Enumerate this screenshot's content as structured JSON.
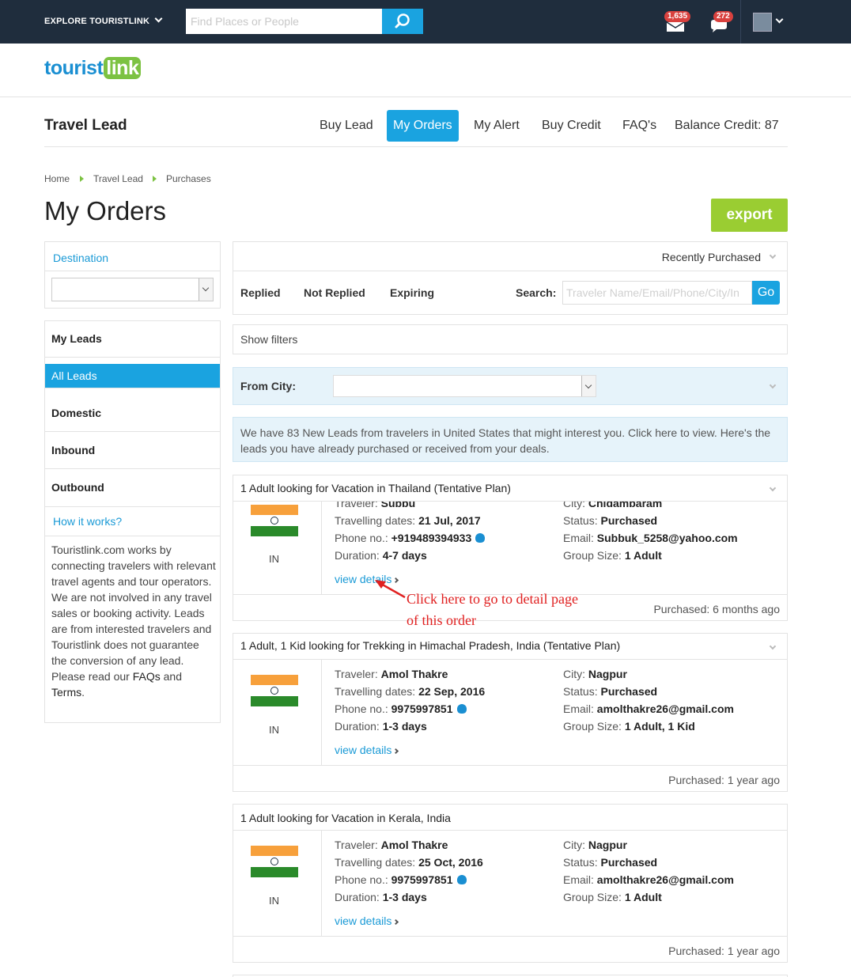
{
  "topbar": {
    "explore_label": "EXPLORE TOURISTLINK",
    "search_placeholder": "Find Places or People",
    "notif_count": "1,635",
    "msg_count": "272"
  },
  "logo": {
    "part1": "tourist",
    "part2": "link"
  },
  "header": {
    "title": "Travel Lead",
    "nav": [
      "Buy Lead",
      "My Orders",
      "My Alert",
      "Buy Credit",
      "FAQ's",
      "Balance Credit: 87"
    ]
  },
  "breadcrumb": [
    "Home",
    "Travel Lead",
    "Purchases"
  ],
  "page": {
    "title": "My Orders",
    "export_label": "export"
  },
  "sidebar": {
    "destination_label": "Destination",
    "menu": [
      "My Leads",
      "All Leads",
      "Domestic",
      "Inbound",
      "Outbound"
    ],
    "how_title": "How it works?",
    "how_text": "Touristlink.com works by connecting travelers with relevant travel agents and tour operators. We are not involved in any travel sales or booking activity. Leads are from interested travelers and Touristlink does not guarantee the conversion of any lead. Please read our ",
    "how_faq": "FAQs",
    "how_and": " and ",
    "how_terms": "Terms",
    "how_end": "."
  },
  "filters": {
    "sort_label": "Recently Purchased",
    "tabs": [
      "Replied",
      "Not Replied",
      "Expiring"
    ],
    "search_label": "Search:",
    "search_placeholder": "Traveler Name/Email/Phone/City/In",
    "go_label": "Go",
    "show_filters": "Show filters",
    "from_city_label": "From City:"
  },
  "info_text": "We have 83 New Leads from travelers in United States that might interest you. Click here to view. Here's the leads you have already purchased or received from your deals.",
  "labels": {
    "traveler": "Traveler:",
    "dates": "Travelling dates:",
    "phone": "Phone no.:",
    "duration": "Duration:",
    "city": "City:",
    "status": "Status:",
    "email": "Email:",
    "group": "Group Size:",
    "view_details": "view details"
  },
  "orders": [
    {
      "title": "1 Adult looking for Vacation in Thailand (Tentative Plan)",
      "country": "IN",
      "traveler": "Subbu",
      "dates": "21 Jul, 2017",
      "phone": "+919489394933",
      "duration": "4-7 days",
      "city": "Chidambaram",
      "status": "Purchased",
      "email": "Subbuk_5258@yahoo.com",
      "group": "1 Adult",
      "purchased": "Purchased: 6 months ago"
    },
    {
      "title": "1 Adult, 1 Kid looking for Trekking in Himachal Pradesh, India (Tentative Plan)",
      "country": "IN",
      "traveler": "Amol Thakre",
      "dates": "22 Sep, 2016",
      "phone": "9975997851",
      "duration": "1-3 days",
      "city": "Nagpur",
      "status": "Purchased",
      "email": "amolthakre26@gmail.com",
      "group": "1 Adult, 1 Kid",
      "purchased": "Purchased: 1 year ago"
    },
    {
      "title": "1 Adult looking for Vacation in Kerala, India",
      "country": "IN",
      "traveler": "Amol Thakre",
      "dates": "25 Oct, 2016",
      "phone": "9975997851",
      "duration": "1-3 days",
      "city": "Nagpur",
      "status": "Purchased",
      "email": "amolthakre26@gmail.com",
      "group": "1 Adult",
      "purchased": "Purchased: 1 year ago"
    }
  ],
  "annotation": {
    "line1": "Click here to go to detail page",
    "line2": "of this order"
  }
}
